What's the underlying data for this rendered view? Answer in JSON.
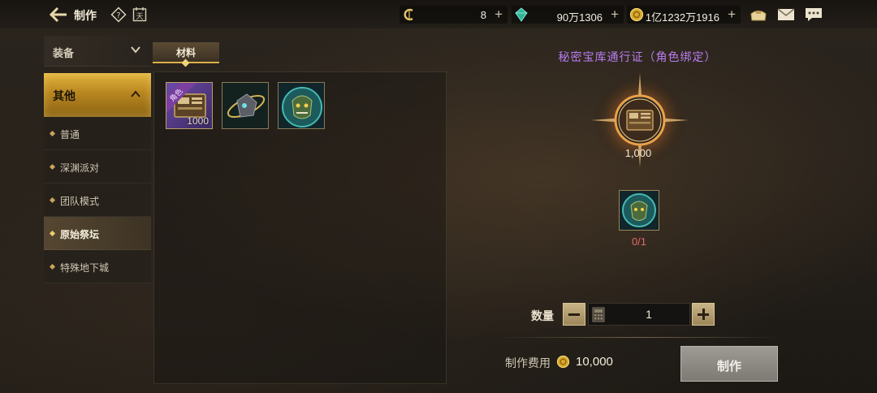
{
  "header": {
    "title": "制作",
    "currencies": [
      {
        "name": "crystal-coin",
        "value": "8"
      },
      {
        "name": "green-gem",
        "value": "90万1306"
      },
      {
        "name": "gold-coin",
        "value": "1亿1232万1916"
      }
    ],
    "calendar_glyph": "天"
  },
  "sidebar": {
    "equip_label": "装备",
    "other_label": "其他",
    "items": [
      {
        "label": "普通"
      },
      {
        "label": "深渊派对"
      },
      {
        "label": "团队模式"
      },
      {
        "label": "原始祭坛"
      },
      {
        "label": "特殊地下城"
      }
    ],
    "active_index": 3
  },
  "materials": {
    "tab_label": "材料",
    "slots": [
      {
        "icon": "pass-book-icon",
        "badge": "角色",
        "count": "1000"
      },
      {
        "icon": "meteor-stone-icon",
        "count": ""
      },
      {
        "icon": "demon-mask-icon",
        "count": ""
      }
    ]
  },
  "craft": {
    "item_name": "秘密宝库通行证（角色绑定）",
    "result_count": "1,000",
    "requirement_count": "0/1",
    "quantity_label": "数量",
    "quantity": "1",
    "cost_label": "制作费用",
    "cost_value": "10,000",
    "craft_button": "制作"
  },
  "colors": {
    "accent_gold": "#d9b04a",
    "item_name_purple": "#b97cf0",
    "requirement_red": "#e26a6a"
  }
}
